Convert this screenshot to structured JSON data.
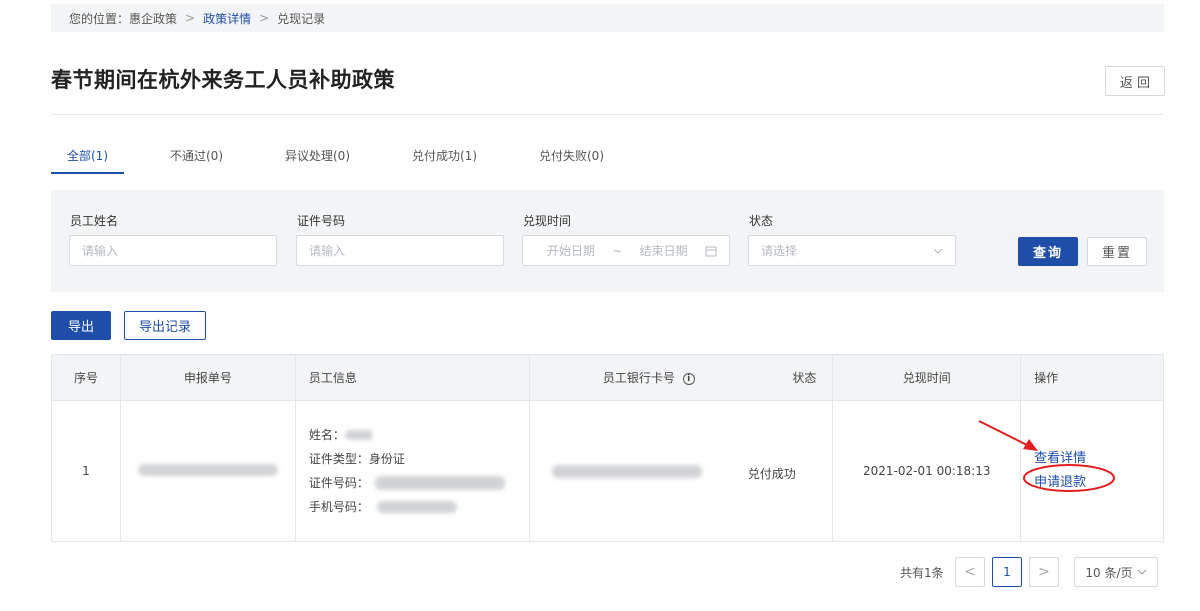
{
  "breadcrumb": {
    "prefix": "您的位置：",
    "items": [
      "惠企政策",
      "政策详情",
      "兑现记录"
    ]
  },
  "title": "春节期间在杭外来务工人员补助政策",
  "back_label": "返 回",
  "tabs": [
    {
      "label": "全部(1)",
      "active": true
    },
    {
      "label": "不通过(0)"
    },
    {
      "label": "异议处理(0)"
    },
    {
      "label": "兑付成功(1)"
    },
    {
      "label": "兑付失败(0)"
    }
  ],
  "filters": {
    "employee_name": {
      "label": "员工姓名",
      "placeholder": "请输入"
    },
    "id_number": {
      "label": "证件号码",
      "placeholder": "请输入"
    },
    "redeem_time": {
      "label": "兑现时间",
      "start_placeholder": "开始日期",
      "range_sep": "~",
      "end_placeholder": "结束日期"
    },
    "status": {
      "label": "状态",
      "placeholder": "请选择"
    },
    "query_label": "查询",
    "reset_label": "重置"
  },
  "actions": {
    "export_label": "导出",
    "export_record_label": "导出记录"
  },
  "table": {
    "headers": {
      "seq": "序号",
      "apply_no": "申报单号",
      "employee_info": "员工信息",
      "bank_card": "员工银行卡号",
      "status": "状态",
      "redeem_time": "兑现时间",
      "operation": "操作"
    },
    "rows": [
      {
        "seq": "1",
        "info_labels": {
          "name": "姓名：",
          "id_type": "证件类型：",
          "id_number": "证件号码：",
          "phone": "手机号码："
        },
        "id_type_value": "身份证",
        "status": "兑付成功",
        "redeem_time": "2021-02-01 00:18:13",
        "ops": {
          "view": "查看详情",
          "refund": "申请退款"
        }
      }
    ]
  },
  "pagination": {
    "total": "共有1条",
    "prev": "<",
    "current": "1",
    "next": ">",
    "page_size": "10 条/页"
  },
  "colors": {
    "primary": "#1f4ea8",
    "annotation": "#e02020"
  }
}
